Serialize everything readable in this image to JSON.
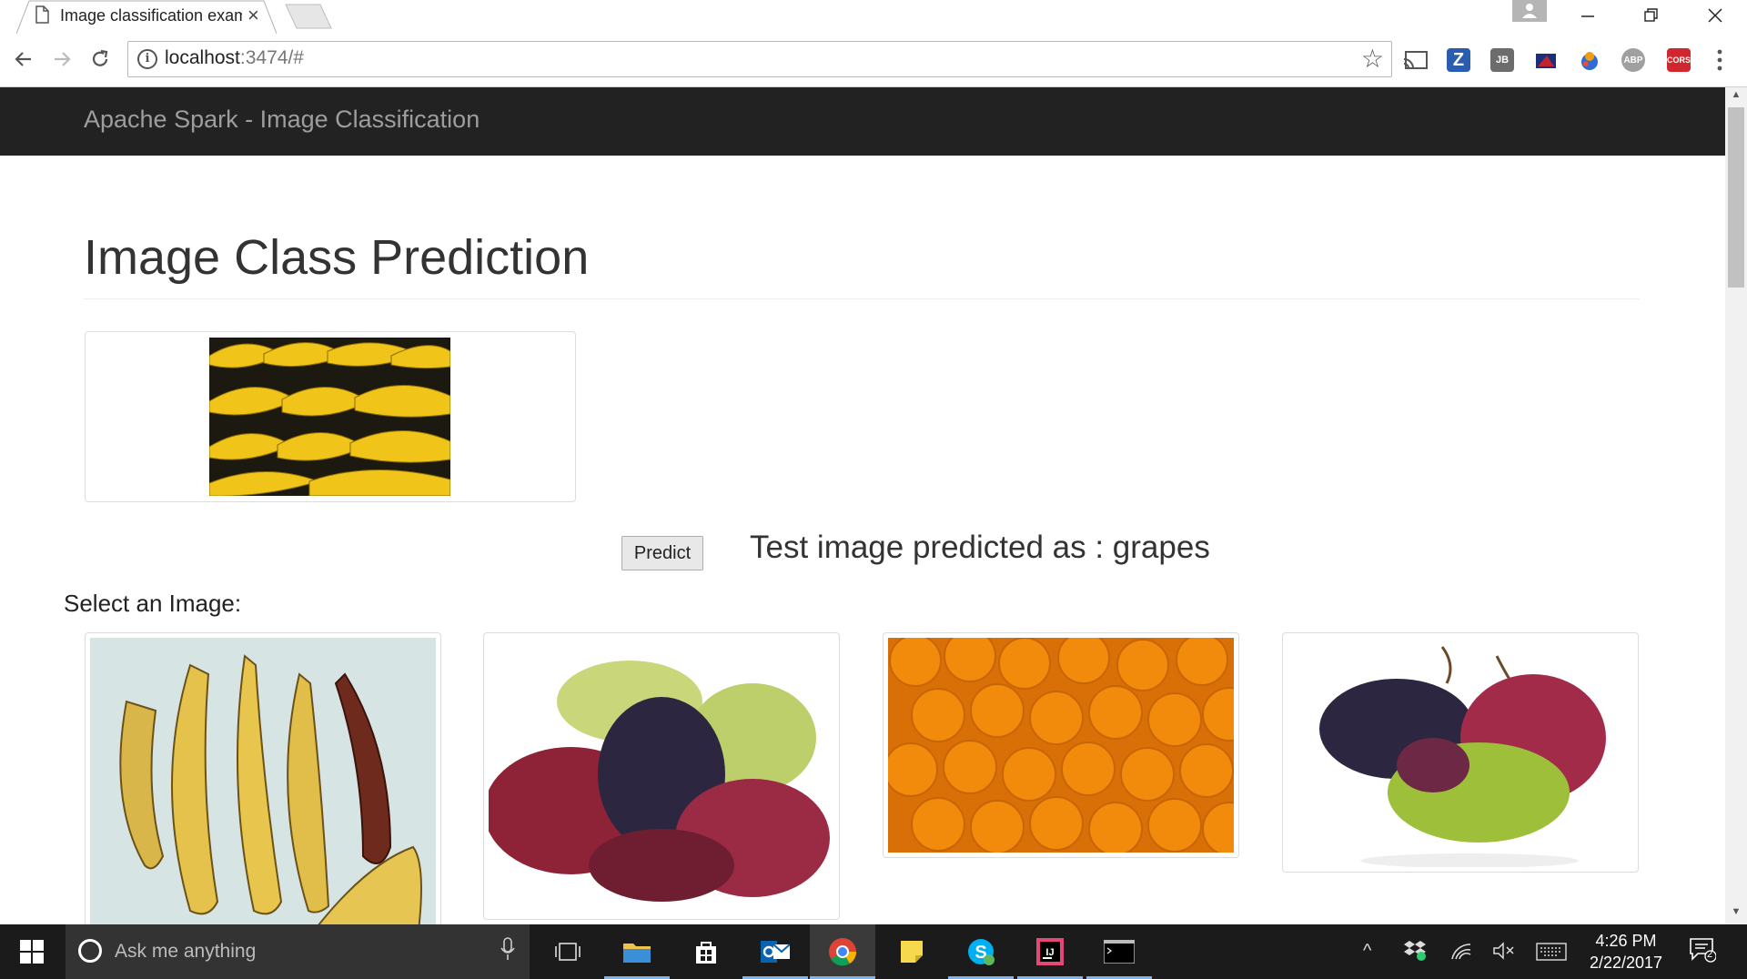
{
  "browser": {
    "tab_title": "Image classification exam",
    "url_host": "localhost",
    "url_rest": ":3474/#"
  },
  "page": {
    "brand": "Apache Spark - Image Classification",
    "title": "Image Class Prediction",
    "predict_label": "Predict",
    "result_text": "Test image predicted as : grapes",
    "select_label": "Select an Image:",
    "gallery": [
      "bananas",
      "grapes",
      "oranges",
      "grapes"
    ]
  },
  "taskbar": {
    "search_placeholder": "Ask me anything",
    "time": "4:26 PM",
    "date": "2/22/2017",
    "notification_count": "2"
  },
  "extensions": [
    "Z",
    "JB",
    "ABP",
    "CORS"
  ],
  "colors": {
    "navbar": "#222222",
    "brand_text": "#9d9d9d",
    "taskbar": "#1b1b1b",
    "banana_yellow": "#f0c419",
    "orange": "#f28a0c",
    "grape_red": "#8e2236",
    "grape_green": "#b6cf4f",
    "grape_dark": "#2c2640"
  }
}
